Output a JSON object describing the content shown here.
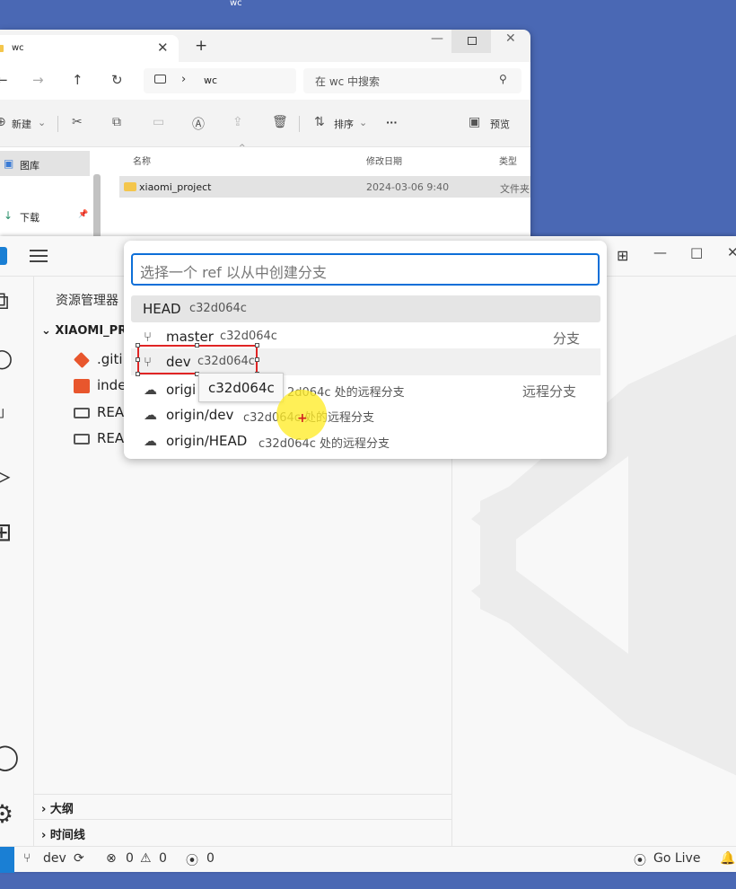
{
  "desktop": {
    "label": "wc"
  },
  "explorer": {
    "tab_title": "wc",
    "new_tab": "+",
    "path": "wc",
    "search_placeholder": "在 wc 中搜索",
    "toolbar": {
      "new": "新建",
      "sort": "排序",
      "more": "···",
      "preview": "预览"
    },
    "sidebar": [
      {
        "label": "图库",
        "selected": true
      },
      {
        "label": "下载",
        "pinned": true
      }
    ],
    "columns": {
      "name": "名称",
      "modified": "修改日期",
      "type": "类型"
    },
    "rows": [
      {
        "name": "xiaomi_project",
        "modified": "2024-03-06 9:40",
        "type": "文件夹"
      }
    ]
  },
  "vscode": {
    "explorer_title": "资源管理器",
    "folder": "XIAOMI_PR",
    "files": [
      {
        "name": ".giti",
        "icon": "git-icon",
        "color": "#e8562d"
      },
      {
        "name": "inde",
        "icon": "html5-icon",
        "color": "#e8562d"
      },
      {
        "name": "REA",
        "icon": "markdown-icon",
        "color": "#555555"
      },
      {
        "name": "REA",
        "icon": "markdown-icon",
        "color": "#555555"
      }
    ],
    "sections": {
      "outline": "大纲",
      "timeline": "时间线"
    },
    "quick_pick": {
      "placeholder": "选择一个 ref 以从中创建分支",
      "items": [
        {
          "label": "HEAD",
          "desc": "c32d064c",
          "right": "",
          "icon": "",
          "highlight": true
        },
        {
          "label": "master",
          "desc": "c32d064c",
          "right": "分支",
          "icon": "branch-icon"
        },
        {
          "label": "dev",
          "desc": "c32d064c",
          "right": "",
          "icon": "branch-icon"
        },
        {
          "label": "origi",
          "desc": "2d064c 处的远程分支",
          "right": "远程分支",
          "icon": "cloud-icon"
        },
        {
          "label": "origin/dev",
          "desc": "c32d064c 处的远程分支",
          "right": "",
          "icon": "cloud-icon"
        },
        {
          "label": "origin/HEAD",
          "desc": "c32d064c 处的远程分支",
          "right": "",
          "icon": "cloud-icon"
        }
      ],
      "tooltip": "c32d064c"
    },
    "status": {
      "branch": "dev",
      "errors": "0",
      "warnings": "0",
      "ports": "0",
      "go_live": "Go Live"
    }
  },
  "colors": {
    "accent": "#0d6fd8",
    "annotation": "#e02424",
    "desktop": "#4a68b4"
  }
}
